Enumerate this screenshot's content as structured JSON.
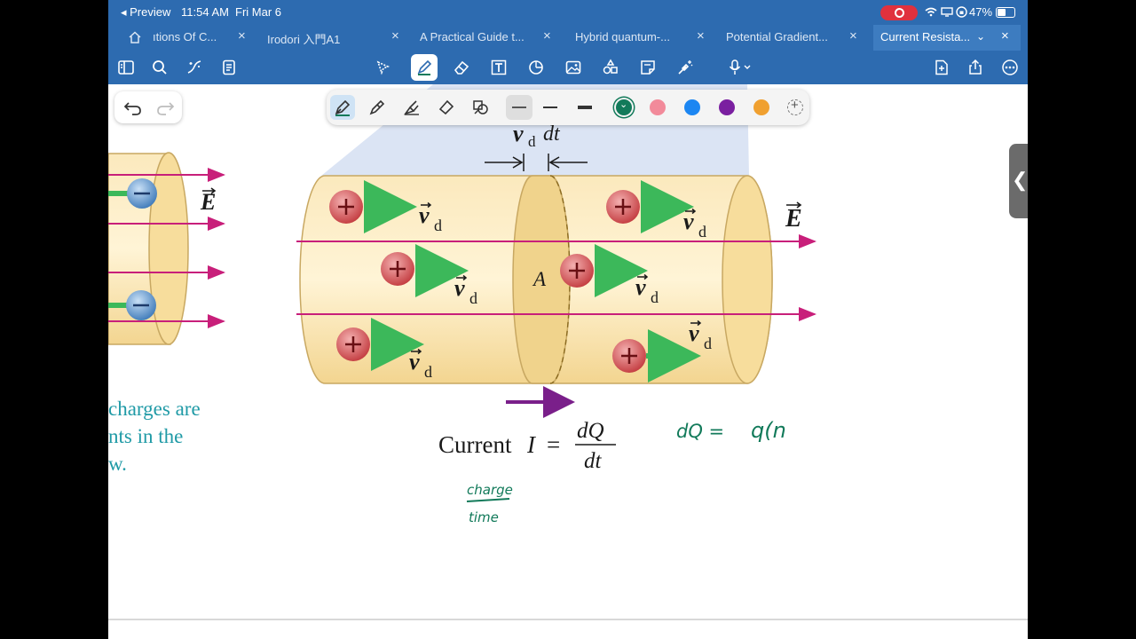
{
  "status": {
    "back_label": "◂ Preview",
    "time": "11:54 AM",
    "date": "Fri Mar 6",
    "battery": "47%"
  },
  "tabs": [
    {
      "label": "ıtions Of C..."
    },
    {
      "label": "Irodori 入門A1"
    },
    {
      "label": "A Practical Guide t..."
    },
    {
      "label": "Hybrid quantum-..."
    },
    {
      "label": "Potential Gradient..."
    },
    {
      "label": "Current Resista..."
    }
  ],
  "toolbar_icons": [
    "sidebar-icon",
    "search-icon",
    "magic-icon",
    "outline-icon",
    "lasso-icon",
    "pen-icon",
    "eraser-icon",
    "text-icon",
    "shapes-icon",
    "image-icon",
    "sticker-icon",
    "note-icon",
    "laser-icon",
    "mic-icon",
    "add-page-icon",
    "share-icon",
    "more-icon"
  ],
  "palette": {
    "colors": [
      "#127a5a",
      "#f28a9a",
      "#1c86f2",
      "#7a1fa0",
      "#f0a030"
    ],
    "selected_color": "#127a5a"
  },
  "figure": {
    "vd_dt": "dt",
    "E": "E",
    "A": "A",
    "vd": "v",
    "d_sub": "d",
    "current_text": "Current",
    "I_symbol": "I",
    "eq": "=",
    "num": "dQ",
    "den": "dt",
    "caption_lines": [
      "charges are",
      "nts in the",
      "w."
    ]
  },
  "handwriting": {
    "dq": "dQ =",
    "q": "q(n",
    "charge": "charge",
    "time": "time"
  }
}
